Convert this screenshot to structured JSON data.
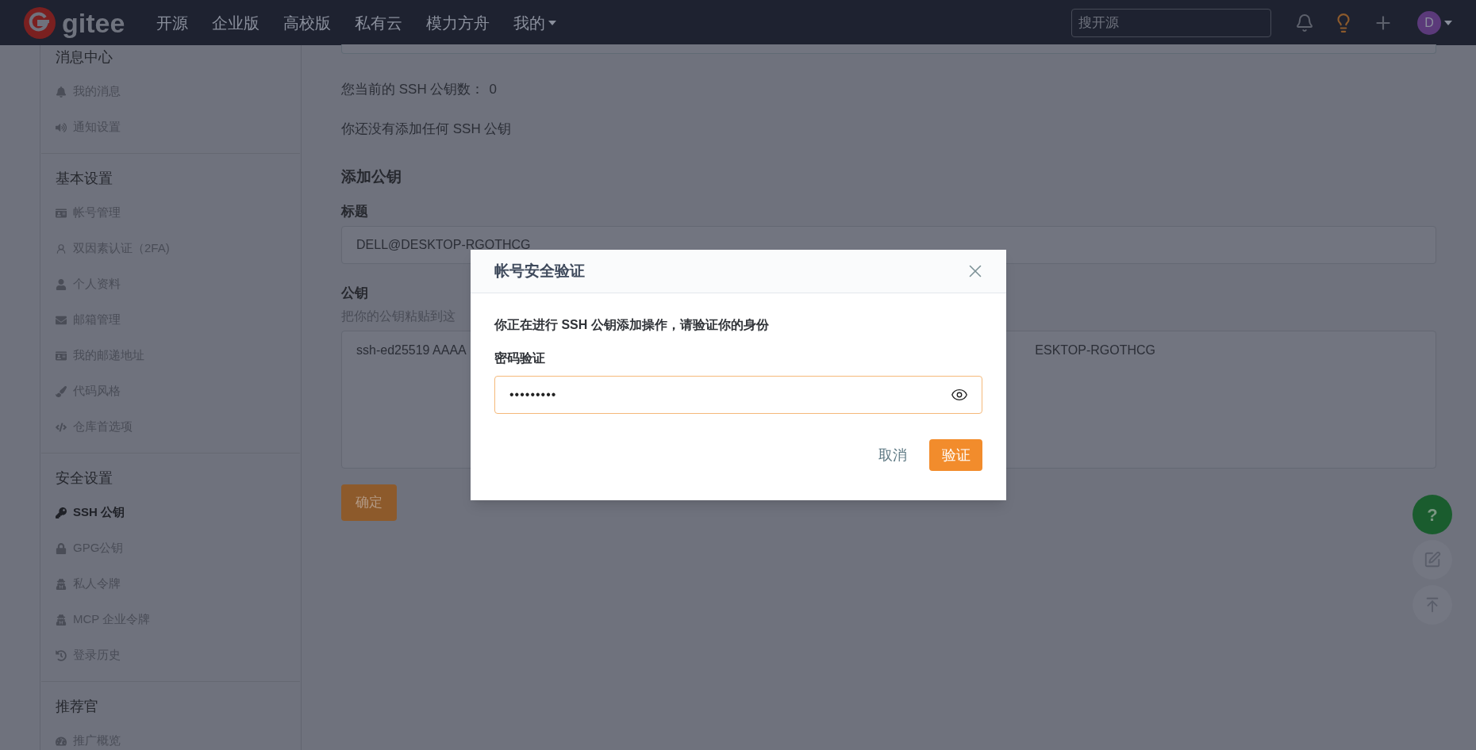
{
  "header": {
    "logo_text": "gitee",
    "nav": [
      {
        "label": "开源",
        "has_menu": false
      },
      {
        "label": "企业版",
        "has_menu": false
      },
      {
        "label": "高校版",
        "has_menu": false
      },
      {
        "label": "私有云",
        "has_menu": false
      },
      {
        "label": "模力方舟",
        "has_menu": false
      },
      {
        "label": "我的",
        "has_menu": true
      }
    ],
    "search": {
      "placeholder": "搜开源"
    },
    "avatar": "D"
  },
  "sidebar": {
    "sections": [
      {
        "title": "消息中心",
        "items": [
          {
            "label": "我的消息",
            "selected": false
          },
          {
            "label": "通知设置",
            "selected": false
          }
        ]
      },
      {
        "title": "基本设置",
        "items": [
          {
            "label": "帐号管理",
            "selected": false
          },
          {
            "label": "双因素认证（2FA)",
            "selected": false
          },
          {
            "label": "个人资料",
            "selected": false
          },
          {
            "label": "邮箱管理",
            "selected": false
          },
          {
            "label": "我的邮递地址",
            "selected": false
          },
          {
            "label": "代码风格",
            "selected": false
          },
          {
            "label": "仓库首选项",
            "selected": false
          }
        ]
      },
      {
        "title": "安全设置",
        "items": [
          {
            "label": "SSH 公钥",
            "selected": true
          },
          {
            "label": "GPG公钥",
            "selected": false
          },
          {
            "label": "私人令牌",
            "selected": false
          },
          {
            "label": "MCP 企业令牌",
            "selected": false
          },
          {
            "label": "登录历史",
            "selected": false
          }
        ]
      },
      {
        "title": "推荐官",
        "items": [
          {
            "label": "推广概览",
            "selected": false
          }
        ]
      }
    ]
  },
  "main": {
    "key_count_label": "您当前的 SSH 公钥数：",
    "key_count": "0",
    "empty_text": "你还没有添加任何 SSH 公钥",
    "add_title": "添加公钥",
    "title_label": "标题",
    "title_value": "DELL@DESKTOP-RGOTHCG",
    "key_label": "公钥",
    "key_hint": "把你的公钥粘贴到这",
    "key_value_left": "ssh-ed25519 AAAA",
    "key_value_right": "ESKTOP-RGOTHCG",
    "submit": "确定"
  },
  "dialog": {
    "title": "帐号安全验证",
    "message": "你正在进行 SSH 公钥添加操作，请验证你的身份",
    "field_label": "密码验证",
    "password": "•••••••••",
    "cancel": "取消",
    "confirm": "验证"
  },
  "float_buttons": {
    "help": "?"
  }
}
